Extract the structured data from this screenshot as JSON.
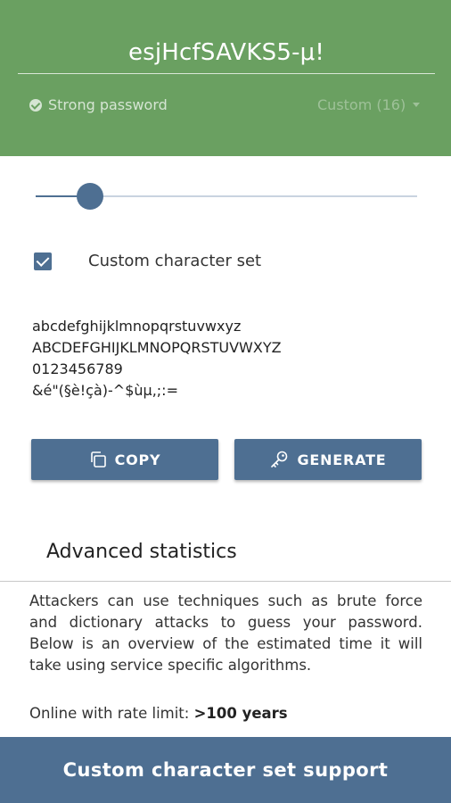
{
  "header": {
    "password": "esjHcfSAVKS5-μ!",
    "strength_label": "Strong password",
    "mode_label": "Custom (16)"
  },
  "slider": {
    "value_fraction": 0.14
  },
  "custom_charset": {
    "checked": true,
    "label": "Custom character set",
    "lines": [
      "abcdefghijklmnopqrstuvwxyz",
      "ABCDEFGHIJKLMNOPQRSTUVWXYZ",
      "0123456789",
      "&é\"(§è!çà)-^$ùμ,;:="
    ]
  },
  "actions": {
    "copy_label": "COPY",
    "generate_label": "GENERATE"
  },
  "advanced": {
    "title": "Advanced statistics",
    "description": "Attackers can use techniques such as brute force and dictionary attacks to guess your password. Below is an overview of the estimated time it will take using service specific algorithms.",
    "online_label": "Online with rate limit:",
    "online_value": ">100 years"
  },
  "banner": {
    "text": "Custom character set support"
  },
  "colors": {
    "header_green": "#6aa061",
    "accent_blue": "#4e6f92"
  }
}
